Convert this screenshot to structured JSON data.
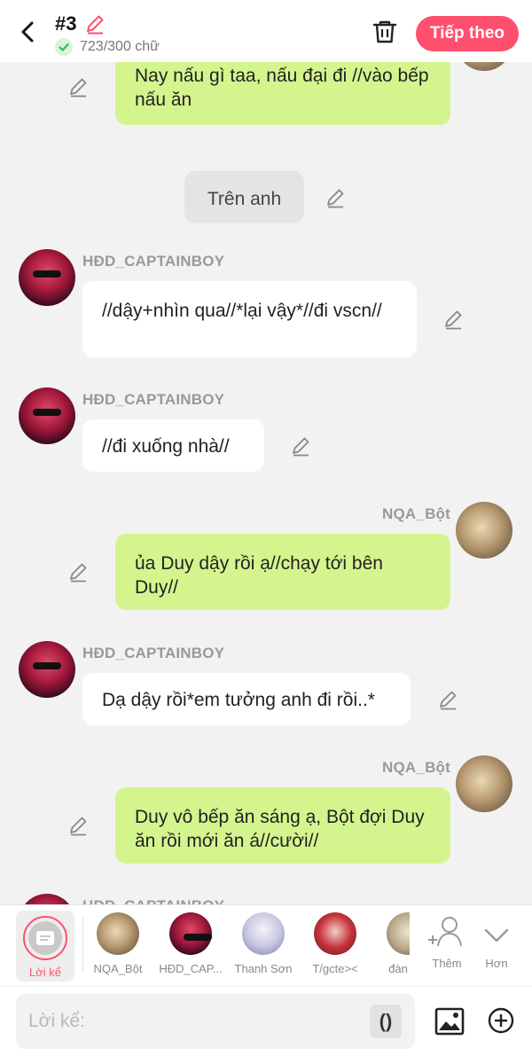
{
  "header": {
    "chapter_number": "#3",
    "word_count": "723/300 chữ",
    "next_button": "Tiếp theo"
  },
  "messages": [
    {
      "type": "bubble",
      "side": "right",
      "text": "Nay nấu gì taa, nấu đại đi //vào bếp nấu ăn"
    },
    {
      "type": "narration",
      "text": "Trên anh"
    },
    {
      "type": "bubble",
      "side": "left",
      "sender": "HĐD_CAPTAINBOY",
      "text": "//dậy+nhìn qua//*lại vậy*//đi vscn//"
    },
    {
      "type": "bubble",
      "side": "left",
      "sender": "HĐD_CAPTAINBOY",
      "text": "//đi xuống nhà//"
    },
    {
      "type": "bubble",
      "side": "right",
      "sender": "NQA_Bột",
      "text": "ủa Duy dậy rồi ạ//chạy tới bên Duy//"
    },
    {
      "type": "bubble",
      "side": "left",
      "sender": "HĐD_CAPTAINBOY",
      "text": "Dạ dậy rồi*em tưởng anh đi rồi..*"
    },
    {
      "type": "bubble",
      "side": "right",
      "sender": "NQA_Bột",
      "text": "Duy vô bếp ăn sáng ạ, Bột đợi Duy ăn rồi mới ăn á//cười//"
    },
    {
      "type": "bubble",
      "side": "left",
      "sender": "HĐD_CAPTAINBOY",
      "text": ""
    }
  ],
  "character_bar": {
    "narrator_label": "Lời kể",
    "characters": [
      {
        "name": "NQA_Bột",
        "avatar": "photo-avatar"
      },
      {
        "name": "HĐD_CAP...",
        "avatar": "photo-avatar"
      },
      {
        "name": "Thanh Sơn",
        "avatar": "anime-avatar"
      },
      {
        "name": "T/gcte><",
        "avatar": "photo-avatar"
      },
      {
        "name": "đàn",
        "avatar": "photo-avatar"
      }
    ],
    "add_label": "Thêm",
    "more_label": "Hơn"
  },
  "input": {
    "placeholder": "Lời kể:",
    "paren_button": "()"
  },
  "colors": {
    "accent": "#ff4f6e",
    "bubble_self": "#d4f58e",
    "bubble_other": "#ffffff",
    "narration": "#e4e4e4",
    "background": "#f2f2f2"
  }
}
